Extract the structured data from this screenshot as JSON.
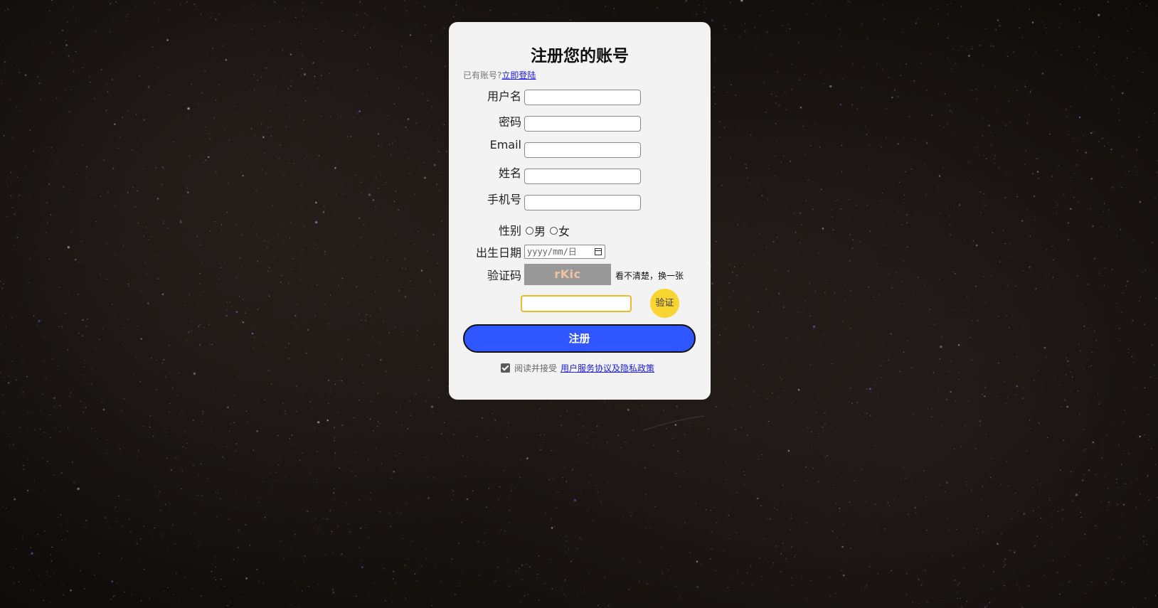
{
  "form": {
    "title": "注册您的账号",
    "login_prompt": "已有账号?",
    "login_link": "立即登陆",
    "fields": {
      "username_label": "用户名",
      "password_label": "密码",
      "email_label": "Email",
      "name_label": "姓名",
      "phone_label": "手机号",
      "gender_label": "性别",
      "gender_male": "男",
      "gender_female": "女",
      "birthdate_label": "出生日期",
      "birthdate_placeholder": "yyyy/mm/日",
      "captcha_label": "验证码"
    },
    "captcha": {
      "code": "rKic",
      "refresh_text": "看不清楚，换一张",
      "verify_button": "验证"
    },
    "register_button": "注册",
    "agreement": {
      "checked": true,
      "prefix": "阅读并接受",
      "link": "用户服务协议及隐私政策"
    }
  },
  "colors": {
    "card_background": "#f3f3f3",
    "register_button": "#2f56ff",
    "verify_button": "#f9d531",
    "captcha_input_border": "#f2b92a",
    "captcha_background": "#999999",
    "link": "#1a1aee"
  },
  "icons": {
    "calendar": "calendar-icon",
    "checkbox": "checkbox-checked-icon"
  }
}
